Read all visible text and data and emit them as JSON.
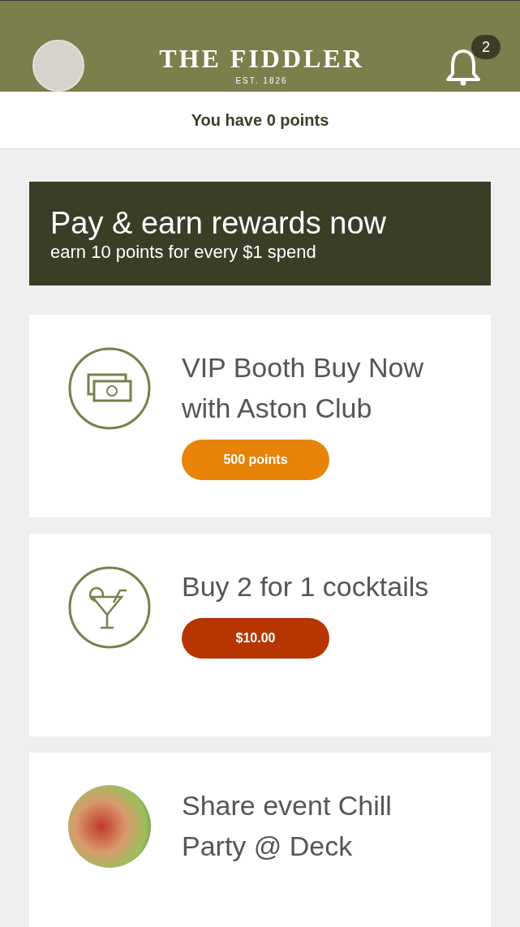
{
  "header": {
    "brand": "THE FIDDLER",
    "established": "EST. 1826",
    "notification_count": "2"
  },
  "points_bar": {
    "text": "You have **0** points"
  },
  "banner": {
    "title": "Pay & earn rewards now",
    "subtitle": "earn 10 points for every $1 spend"
  },
  "offers": [
    {
      "kind": "cash",
      "title": "VIP Booth Buy Now with Aston Club",
      "button": {
        "label": "500 points",
        "color": "#e8830a"
      }
    },
    {
      "kind": "cocktail",
      "title": "Buy 2 for 1 cocktails",
      "button": {
        "label": "$10.00",
        "color": "#b83400"
      }
    },
    {
      "kind": "photo",
      "title": "Share event Chill Party @ Deck"
    }
  ]
}
